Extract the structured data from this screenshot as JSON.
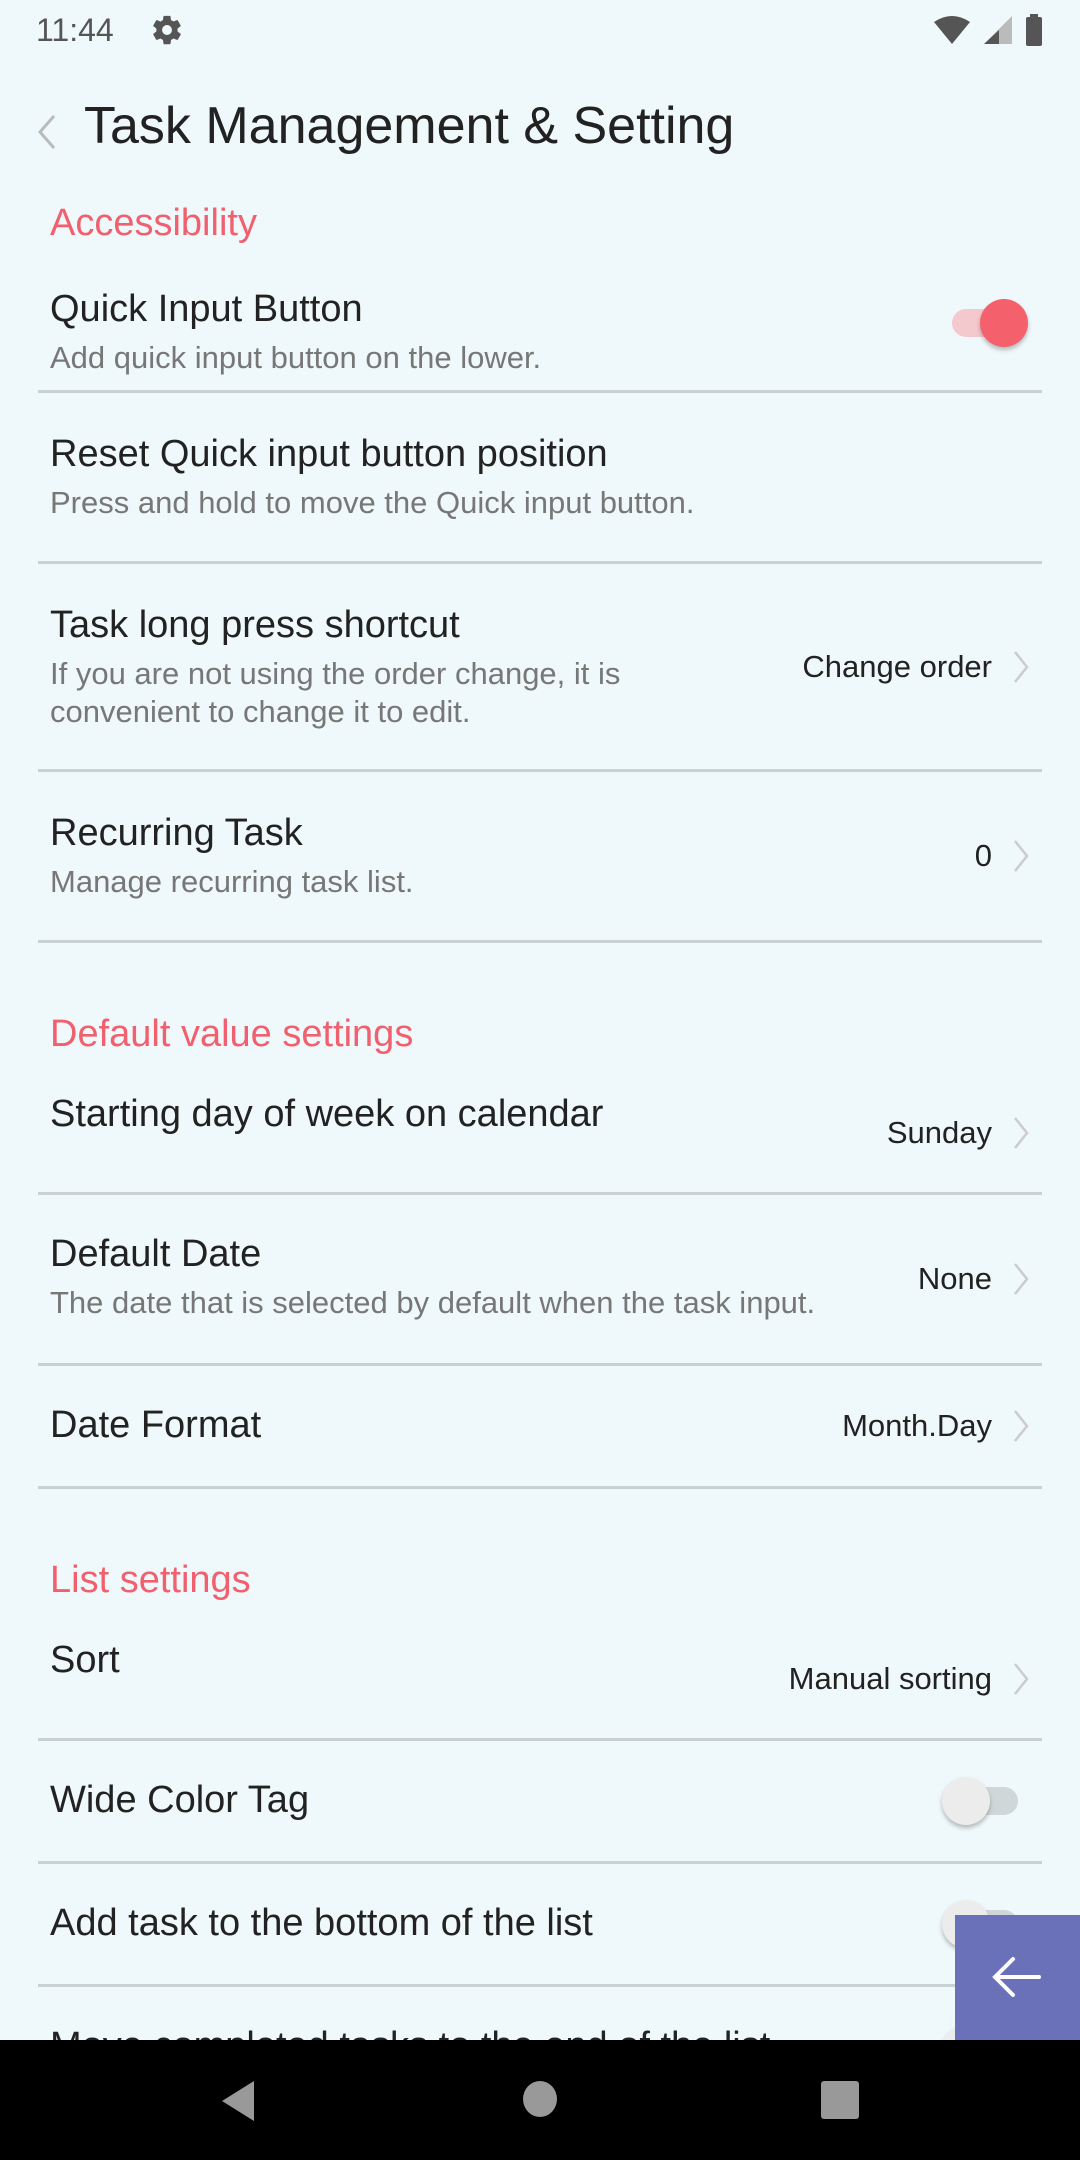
{
  "status_bar": {
    "time": "11:44",
    "icons": [
      "gear-icon",
      "wifi-icon",
      "signal-icon",
      "battery-icon"
    ]
  },
  "header": {
    "back_icon": "chevron-left-icon",
    "title": "Task Management & Setting"
  },
  "colors": {
    "accent": "#f0606e",
    "background": "#eff8fa",
    "fab": "#6b71b8"
  },
  "sections": {
    "accessibility": {
      "label": "Accessibility",
      "items": {
        "quick_input": {
          "title": "Quick Input Button",
          "subtitle": "Add quick input button on the lower.",
          "toggle": true
        },
        "reset_position": {
          "title": "Reset Quick input button position",
          "subtitle": "Press and hold to move the Quick input button."
        },
        "long_press": {
          "title": "Task long press shortcut",
          "subtitle": "If you are not using the order change, it is convenient to change it to edit.",
          "value": "Change order"
        },
        "recurring": {
          "title": "Recurring Task",
          "subtitle": "Manage recurring task list.",
          "value": "0"
        }
      }
    },
    "defaults": {
      "label": "Default value settings",
      "items": {
        "start_day": {
          "title": "Starting day of week on calendar",
          "value": "Sunday"
        },
        "default_date": {
          "title": "Default Date",
          "subtitle": "The date that is selected by default when the task input.",
          "value": "None"
        },
        "date_format": {
          "title": "Date Format",
          "value": "Month.Day"
        }
      }
    },
    "list": {
      "label": "List settings",
      "items": {
        "sort": {
          "title": "Sort",
          "value": "Manual sorting"
        },
        "wide_color_tag": {
          "title": "Wide Color Tag",
          "toggle": false
        },
        "add_bottom": {
          "title": "Add task to the bottom of the list",
          "toggle": false
        },
        "partial": {
          "title": "Move completed tasks to the end of the list",
          "toggle": false
        }
      }
    }
  },
  "fab": {
    "icon": "arrow-left-icon"
  },
  "nav_bar": {
    "icons": [
      "nav-back-icon",
      "nav-home-icon",
      "nav-recents-icon"
    ]
  }
}
